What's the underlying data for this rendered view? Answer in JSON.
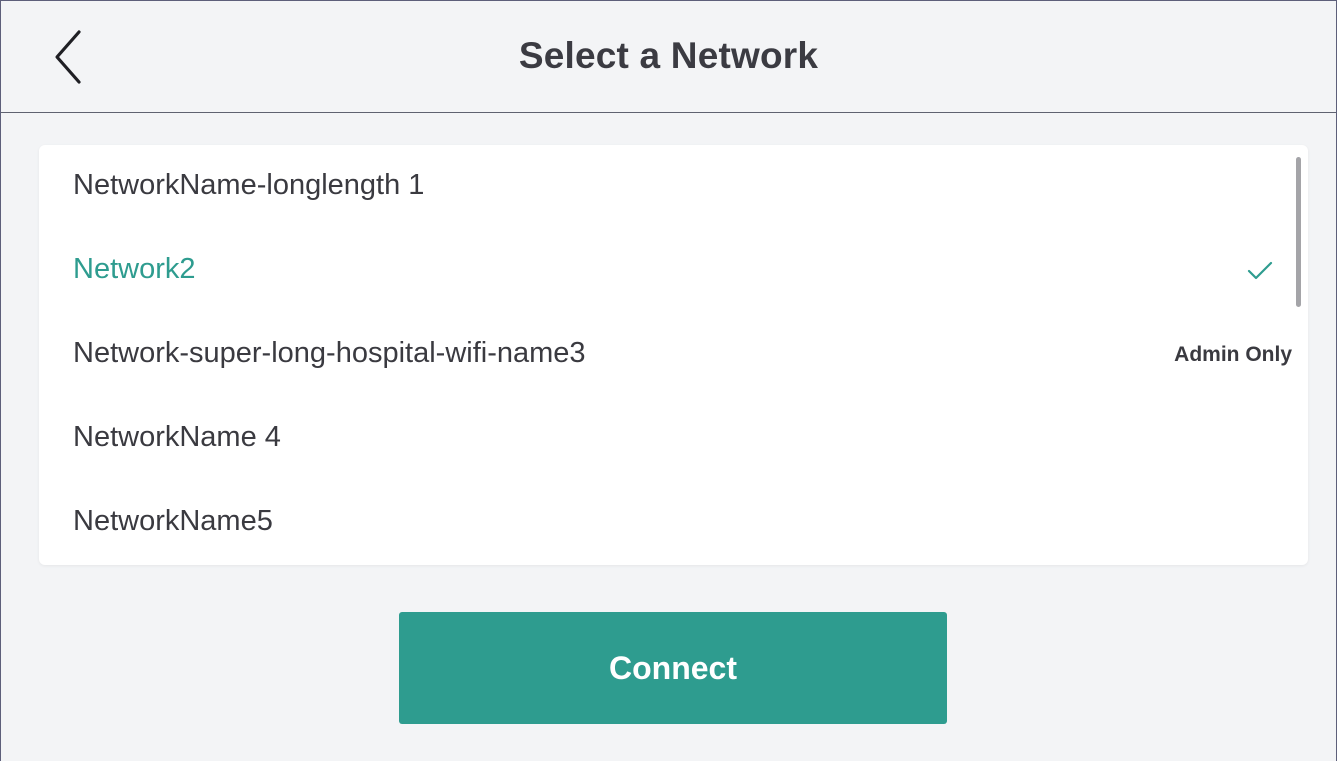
{
  "header": {
    "title": "Select a Network",
    "back_icon": "chevron-left-icon"
  },
  "networks": [
    {
      "name": "NetworkName-longlength 1",
      "selected": false,
      "badge": ""
    },
    {
      "name": "Network2",
      "selected": true,
      "badge": ""
    },
    {
      "name": "Network-super-long-hospital-wifi-name3",
      "selected": false,
      "badge": "Admin Only"
    },
    {
      "name": "NetworkName 4",
      "selected": false,
      "badge": ""
    },
    {
      "name": "NetworkName5",
      "selected": false,
      "badge": ""
    }
  ],
  "selected_icon": "check-icon",
  "connect_button": {
    "label": "Connect"
  },
  "colors": {
    "accent": "#2e9c8f",
    "background": "#f3f4f6",
    "card": "#ffffff",
    "text": "#3a3a40"
  }
}
